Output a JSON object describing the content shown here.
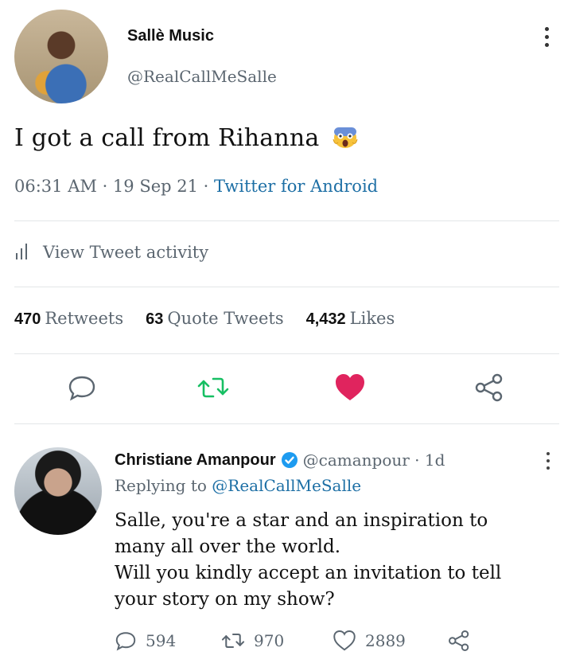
{
  "main_tweet": {
    "display_name": "Sallè Music",
    "handle": "@RealCallMeSalle",
    "text": "I got a call from Rihanna",
    "emoji": "scream-emoji",
    "time": "06:31 AM",
    "date": "19 Sep 21",
    "source": "Twitter for Android",
    "activity_label": "View Tweet activity",
    "stats": {
      "retweets_count": "470",
      "retweets_label": "Retweets",
      "quotes_count": "63",
      "quotes_label": "Quote Tweets",
      "likes_count": "4,432",
      "likes_label": "Likes"
    },
    "actions": [
      "reply-icon",
      "retweet-icon",
      "like-icon",
      "share-icon"
    ],
    "colors": {
      "retweet": "#17bf63",
      "like": "#e0245e",
      "link": "#1d6fa5"
    }
  },
  "reply_tweet": {
    "display_name": "Christiane Amanpour",
    "handle": "@camanpour",
    "time_ago": "1d",
    "replying_prefix": "Replying to",
    "replying_to": "@RealCallMeSalle",
    "lines": [
      "Salle, you're a star and an inspiration to",
      "many all over the world.",
      "Will you kindly accept an invitation to tell",
      "your story on my show?"
    ],
    "replies": "594",
    "retweets": "970",
    "likes": "2889",
    "colors": {
      "verified": "#1d9bf0"
    }
  }
}
